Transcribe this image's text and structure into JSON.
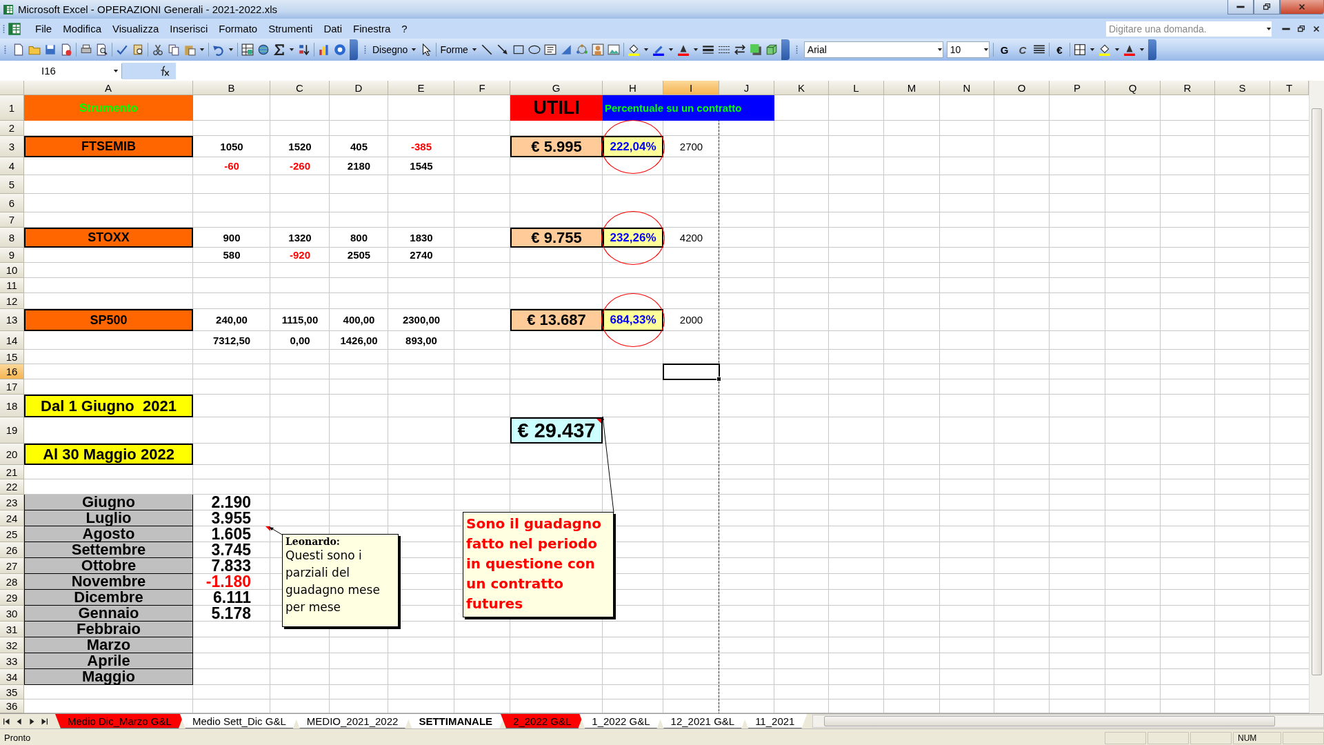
{
  "window": {
    "title": "Microsoft Excel - OPERAZIONI Generali - 2021-2022.xls"
  },
  "menu": [
    "File",
    "Modifica",
    "Visualizza",
    "Inserisci",
    "Formato",
    "Strumenti",
    "Dati",
    "Finestra",
    "?"
  ],
  "help_box": {
    "placeholder": "Digitare una domanda."
  },
  "toolbar": {
    "drawing_menus": [
      "Disegno",
      "Forme"
    ],
    "font": "Arial",
    "font_size": "10",
    "format_buttons": [
      "G",
      "C",
      "€"
    ]
  },
  "formula_bar": {
    "name_box": "I16"
  },
  "sheet": {
    "columns": [
      {
        "label": "A",
        "selected": false
      },
      {
        "label": "B",
        "selected": false
      },
      {
        "label": "C",
        "selected": false
      },
      {
        "label": "D",
        "selected": false
      },
      {
        "label": "E",
        "selected": false
      },
      {
        "label": "F",
        "selected": false
      },
      {
        "label": "G",
        "selected": false
      },
      {
        "label": "H",
        "selected": false
      },
      {
        "label": "I",
        "selected": true
      },
      {
        "label": "J",
        "selected": false
      },
      {
        "label": "K",
        "selected": false
      },
      {
        "label": "L",
        "selected": false
      },
      {
        "label": "M",
        "selected": false
      },
      {
        "label": "N",
        "selected": false
      },
      {
        "label": "O",
        "selected": false
      },
      {
        "label": "P",
        "selected": false
      },
      {
        "label": "Q",
        "selected": false
      },
      {
        "label": "R",
        "selected": false
      },
      {
        "label": "S",
        "selected": false
      },
      {
        "label": "T",
        "selected": false
      }
    ],
    "rows": [
      {
        "label": "1",
        "selected": false,
        "cells": [
          {
            "text": "Strumento",
            "kind": "instrument-header"
          },
          "",
          "",
          "",
          "",
          "",
          {
            "text": "UTILI",
            "kind": "utili"
          },
          {
            "text": "Percentuale su un contratto",
            "kind": "pct-header"
          },
          {
            "kind": "pct-header"
          },
          {
            "kind": "pct-header"
          }
        ]
      },
      {
        "label": "2",
        "selected": false,
        "cells": []
      },
      {
        "label": "3",
        "selected": false,
        "cells": [
          {
            "text": "FTSEMIB",
            "kind": "instrument"
          },
          {
            "text": "1050",
            "kind": "value",
            "negative": false
          },
          {
            "text": "1520",
            "kind": "value",
            "negative": false
          },
          {
            "text": "405",
            "kind": "value",
            "negative": false
          },
          {
            "text": "-385",
            "kind": "value",
            "negative": true
          },
          "",
          {
            "text": "€ 5.995",
            "kind": "profit"
          },
          {
            "text": "222,04%",
            "kind": "percent",
            "circled": true
          },
          {
            "text": "2700",
            "kind": "plain"
          }
        ]
      },
      {
        "label": "4",
        "selected": false,
        "cells": [
          "",
          {
            "text": "-60",
            "kind": "value",
            "negative": true
          },
          {
            "text": "-260",
            "kind": "value",
            "negative": true
          },
          {
            "text": "2180",
            "kind": "value",
            "negative": false
          },
          {
            "text": "1545",
            "kind": "value",
            "negative": false
          }
        ]
      },
      {
        "label": "5",
        "selected": false,
        "cells": []
      },
      {
        "label": "6",
        "selected": false,
        "cells": []
      },
      {
        "label": "7",
        "selected": false,
        "cells": []
      },
      {
        "label": "8",
        "selected": false,
        "cells": [
          {
            "text": "STOXX",
            "kind": "instrument"
          },
          {
            "text": "900",
            "kind": "value",
            "negative": false
          },
          {
            "text": "1320",
            "kind": "value",
            "negative": false
          },
          {
            "text": "800",
            "kind": "value",
            "negative": false
          },
          {
            "text": "1830",
            "kind": "value",
            "negative": false
          },
          "",
          {
            "text": "€ 9.755",
            "kind": "profit"
          },
          {
            "text": "232,26%",
            "kind": "percent",
            "circled": true
          },
          {
            "text": "4200",
            "kind": "plain"
          }
        ]
      },
      {
        "label": "9",
        "selected": false,
        "cells": [
          "",
          {
            "text": "580",
            "kind": "value",
            "negative": false
          },
          {
            "text": "-920",
            "kind": "value",
            "negative": true
          },
          {
            "text": "2505",
            "kind": "value",
            "negative": false
          },
          {
            "text": "2740",
            "kind": "value",
            "negative": false
          }
        ]
      },
      {
        "label": "10",
        "selected": false,
        "cells": []
      },
      {
        "label": "11",
        "selected": false,
        "cells": []
      },
      {
        "label": "12",
        "selected": false,
        "cells": []
      },
      {
        "label": "13",
        "selected": false,
        "cells": [
          {
            "text": "SP500",
            "kind": "instrument"
          },
          {
            "text": "240,00",
            "kind": "value",
            "negative": false
          },
          {
            "text": "1115,00",
            "kind": "value",
            "negative": false
          },
          {
            "text": "400,00",
            "kind": "value",
            "negative": false
          },
          {
            "text": "2300,00",
            "kind": "value",
            "negative": false
          },
          "",
          {
            "text": "€ 13.687",
            "kind": "profit"
          },
          {
            "text": "684,33%",
            "kind": "percent",
            "circled": true
          },
          {
            "text": "2000",
            "kind": "plain"
          }
        ]
      },
      {
        "label": "14",
        "selected": false,
        "cells": [
          "",
          {
            "text": "7312,50",
            "kind": "value",
            "negative": false
          },
          {
            "text": "0,00",
            "kind": "value",
            "negative": false
          },
          {
            "text": "1426,00",
            "kind": "value",
            "negative": false
          },
          {
            "text": "893,00",
            "kind": "value",
            "negative": false
          }
        ]
      },
      {
        "label": "15",
        "selected": false,
        "cells": []
      },
      {
        "label": "16",
        "selected": true,
        "cells": []
      },
      {
        "label": "17",
        "selected": false,
        "cells": []
      },
      {
        "label": "18",
        "selected": false,
        "cells": [
          {
            "text": "Dal 1 Giugno  2021",
            "kind": "date"
          }
        ]
      },
      {
        "label": "19",
        "selected": false,
        "cells": [
          "",
          "",
          "",
          "",
          "",
          "",
          {
            "text": "€ 29.437",
            "kind": "total",
            "comment": true
          }
        ]
      },
      {
        "label": "20",
        "selected": false,
        "cells": [
          {
            "text": "Al 30 Maggio 2022",
            "kind": "date"
          }
        ]
      },
      {
        "label": "21",
        "selected": false,
        "cells": []
      },
      {
        "label": "22",
        "selected": false,
        "cells": []
      },
      {
        "label": "23",
        "selected": false,
        "cells": [
          {
            "text": "Giugno",
            "kind": "month"
          },
          {
            "text": "2.190",
            "kind": "monthly",
            "negative": false,
            "comment": false
          }
        ]
      },
      {
        "label": "24",
        "selected": false,
        "cells": [
          {
            "text": "Luglio",
            "kind": "month"
          },
          {
            "text": "3.955",
            "kind": "monthly",
            "negative": false,
            "comment": false
          }
        ]
      },
      {
        "label": "25",
        "selected": false,
        "cells": [
          {
            "text": "Agosto",
            "kind": "month"
          },
          {
            "text": "1.605",
            "kind": "monthly",
            "negative": false,
            "comment": true
          }
        ]
      },
      {
        "label": "26",
        "selected": false,
        "cells": [
          {
            "text": "Settembre",
            "kind": "month"
          },
          {
            "text": "3.745",
            "kind": "monthly",
            "negative": false,
            "comment": false
          }
        ]
      },
      {
        "label": "27",
        "selected": false,
        "cells": [
          {
            "text": "Ottobre",
            "kind": "month"
          },
          {
            "text": "7.833",
            "kind": "monthly",
            "negative": false,
            "comment": false
          }
        ]
      },
      {
        "label": "28",
        "selected": false,
        "cells": [
          {
            "text": "Novembre",
            "kind": "month"
          },
          {
            "text": "-1.180",
            "kind": "monthly",
            "negative": true,
            "comment": false
          }
        ]
      },
      {
        "label": "29",
        "selected": false,
        "cells": [
          {
            "text": "Dicembre",
            "kind": "month"
          },
          {
            "text": "6.111",
            "kind": "monthly",
            "negative": false,
            "comment": false
          }
        ]
      },
      {
        "label": "30",
        "selected": false,
        "cells": [
          {
            "text": "Gennaio",
            "kind": "month"
          },
          {
            "text": "5.178",
            "kind": "monthly",
            "negative": false,
            "comment": false
          }
        ]
      },
      {
        "label": "31",
        "selected": false,
        "cells": [
          {
            "text": "Febbraio",
            "kind": "month"
          }
        ]
      },
      {
        "label": "32",
        "selected": false,
        "cells": [
          {
            "text": "Marzo",
            "kind": "month"
          }
        ]
      },
      {
        "label": "33",
        "selected": false,
        "cells": [
          {
            "text": "Aprile",
            "kind": "month"
          }
        ]
      },
      {
        "label": "34",
        "selected": false,
        "cells": [
          {
            "text": "Maggio",
            "kind": "month"
          }
        ]
      },
      {
        "label": "35",
        "selected": false,
        "cells": []
      },
      {
        "label": "36",
        "selected": false,
        "cells": []
      }
    ],
    "comments": [
      {
        "kind": "note",
        "author": "Leonardo:",
        "text": "Questi sono i parziali del guadagno mese per mese"
      },
      {
        "kind": "callout",
        "text": "Sono il guadagno fatto nel periodo in questione con un contratto futures"
      }
    ]
  },
  "sheet_tabs": [
    {
      "label": "Medio Dic_Marzo G&L",
      "selected": false,
      "color": "#ff0000"
    },
    {
      "label": "Medio Sett_Dic G&L",
      "selected": false,
      "color": "#ffffff"
    },
    {
      "label": "MEDIO_2021_2022",
      "selected": false,
      "color": "#ffffff"
    },
    {
      "label": "SETTIMANALE",
      "selected": true,
      "color": "#ffffff"
    },
    {
      "label": "2_2022 G&L",
      "selected": false,
      "color": "#ff0000"
    },
    {
      "label": "1_2022 G&L",
      "selected": false,
      "color": "#ffffff"
    },
    {
      "label": "12_2021 G&L",
      "selected": false,
      "color": "#ffffff"
    },
    {
      "label": "11_2021",
      "selected": false,
      "color": "#ffffff"
    }
  ],
  "status_bar": {
    "text": "Pronto",
    "indicator": "NUM"
  }
}
